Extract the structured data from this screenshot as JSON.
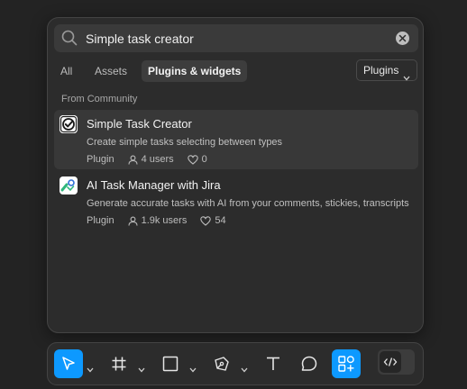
{
  "search": {
    "value": "Simple task creator",
    "placeholder": "Search"
  },
  "tabs": [
    {
      "label": "All",
      "active": false
    },
    {
      "label": "Assets",
      "active": false
    },
    {
      "label": "Plugins & widgets",
      "active": true
    }
  ],
  "filter_dropdown": {
    "label": "Plugins"
  },
  "section_label": "From Community",
  "results": [
    {
      "title": "Simple Task Creator",
      "description": "Create simple tasks selecting between types",
      "type": "Plugin",
      "users": "4 users",
      "likes": "0",
      "icon": "checkmark-badge-icon"
    },
    {
      "title": "AI Task Manager with Jira",
      "description": "Generate accurate tasks with AI from your comments, stickies, transcripts",
      "type": "Plugin",
      "users": "1.9k users",
      "likes": "54",
      "icon": "ai-task-manager-logo"
    }
  ],
  "toolbar": {
    "tools": [
      "move",
      "frame",
      "shape",
      "pen",
      "text",
      "comment",
      "actions",
      "dev-mode"
    ],
    "active": [
      "move",
      "actions"
    ],
    "accent": "#0d99ff"
  }
}
